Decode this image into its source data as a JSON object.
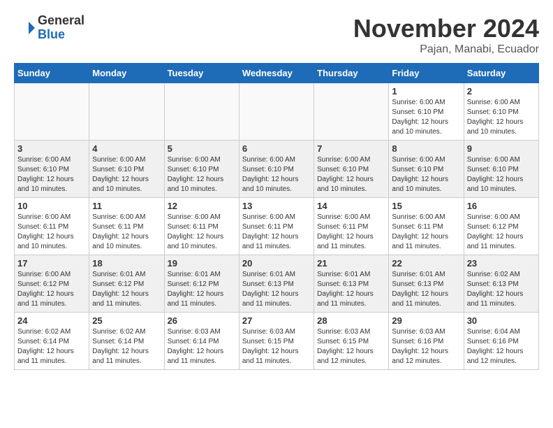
{
  "header": {
    "logo_general": "General",
    "logo_blue": "Blue",
    "month_title": "November 2024",
    "location": "Pajan, Manabi, Ecuador"
  },
  "days_of_week": [
    "Sunday",
    "Monday",
    "Tuesday",
    "Wednesday",
    "Thursday",
    "Friday",
    "Saturday"
  ],
  "weeks": [
    [
      {
        "day": "",
        "info": ""
      },
      {
        "day": "",
        "info": ""
      },
      {
        "day": "",
        "info": ""
      },
      {
        "day": "",
        "info": ""
      },
      {
        "day": "",
        "info": ""
      },
      {
        "day": "1",
        "info": "Sunrise: 6:00 AM\nSunset: 6:10 PM\nDaylight: 12 hours and 10 minutes."
      },
      {
        "day": "2",
        "info": "Sunrise: 6:00 AM\nSunset: 6:10 PM\nDaylight: 12 hours and 10 minutes."
      }
    ],
    [
      {
        "day": "3",
        "info": "Sunrise: 6:00 AM\nSunset: 6:10 PM\nDaylight: 12 hours and 10 minutes."
      },
      {
        "day": "4",
        "info": "Sunrise: 6:00 AM\nSunset: 6:10 PM\nDaylight: 12 hours and 10 minutes."
      },
      {
        "day": "5",
        "info": "Sunrise: 6:00 AM\nSunset: 6:10 PM\nDaylight: 12 hours and 10 minutes."
      },
      {
        "day": "6",
        "info": "Sunrise: 6:00 AM\nSunset: 6:10 PM\nDaylight: 12 hours and 10 minutes."
      },
      {
        "day": "7",
        "info": "Sunrise: 6:00 AM\nSunset: 6:10 PM\nDaylight: 12 hours and 10 minutes."
      },
      {
        "day": "8",
        "info": "Sunrise: 6:00 AM\nSunset: 6:10 PM\nDaylight: 12 hours and 10 minutes."
      },
      {
        "day": "9",
        "info": "Sunrise: 6:00 AM\nSunset: 6:10 PM\nDaylight: 12 hours and 10 minutes."
      }
    ],
    [
      {
        "day": "10",
        "info": "Sunrise: 6:00 AM\nSunset: 6:11 PM\nDaylight: 12 hours and 10 minutes."
      },
      {
        "day": "11",
        "info": "Sunrise: 6:00 AM\nSunset: 6:11 PM\nDaylight: 12 hours and 10 minutes."
      },
      {
        "day": "12",
        "info": "Sunrise: 6:00 AM\nSunset: 6:11 PM\nDaylight: 12 hours and 10 minutes."
      },
      {
        "day": "13",
        "info": "Sunrise: 6:00 AM\nSunset: 6:11 PM\nDaylight: 12 hours and 11 minutes."
      },
      {
        "day": "14",
        "info": "Sunrise: 6:00 AM\nSunset: 6:11 PM\nDaylight: 12 hours and 11 minutes."
      },
      {
        "day": "15",
        "info": "Sunrise: 6:00 AM\nSunset: 6:11 PM\nDaylight: 12 hours and 11 minutes."
      },
      {
        "day": "16",
        "info": "Sunrise: 6:00 AM\nSunset: 6:12 PM\nDaylight: 12 hours and 11 minutes."
      }
    ],
    [
      {
        "day": "17",
        "info": "Sunrise: 6:00 AM\nSunset: 6:12 PM\nDaylight: 12 hours and 11 minutes."
      },
      {
        "day": "18",
        "info": "Sunrise: 6:01 AM\nSunset: 6:12 PM\nDaylight: 12 hours and 11 minutes."
      },
      {
        "day": "19",
        "info": "Sunrise: 6:01 AM\nSunset: 6:12 PM\nDaylight: 12 hours and 11 minutes."
      },
      {
        "day": "20",
        "info": "Sunrise: 6:01 AM\nSunset: 6:13 PM\nDaylight: 12 hours and 11 minutes."
      },
      {
        "day": "21",
        "info": "Sunrise: 6:01 AM\nSunset: 6:13 PM\nDaylight: 12 hours and 11 minutes."
      },
      {
        "day": "22",
        "info": "Sunrise: 6:01 AM\nSunset: 6:13 PM\nDaylight: 12 hours and 11 minutes."
      },
      {
        "day": "23",
        "info": "Sunrise: 6:02 AM\nSunset: 6:13 PM\nDaylight: 12 hours and 11 minutes."
      }
    ],
    [
      {
        "day": "24",
        "info": "Sunrise: 6:02 AM\nSunset: 6:14 PM\nDaylight: 12 hours and 11 minutes."
      },
      {
        "day": "25",
        "info": "Sunrise: 6:02 AM\nSunset: 6:14 PM\nDaylight: 12 hours and 11 minutes."
      },
      {
        "day": "26",
        "info": "Sunrise: 6:03 AM\nSunset: 6:14 PM\nDaylight: 12 hours and 11 minutes."
      },
      {
        "day": "27",
        "info": "Sunrise: 6:03 AM\nSunset: 6:15 PM\nDaylight: 12 hours and 11 minutes."
      },
      {
        "day": "28",
        "info": "Sunrise: 6:03 AM\nSunset: 6:15 PM\nDaylight: 12 hours and 12 minutes."
      },
      {
        "day": "29",
        "info": "Sunrise: 6:03 AM\nSunset: 6:16 PM\nDaylight: 12 hours and 12 minutes."
      },
      {
        "day": "30",
        "info": "Sunrise: 6:04 AM\nSunset: 6:16 PM\nDaylight: 12 hours and 12 minutes."
      }
    ]
  ]
}
